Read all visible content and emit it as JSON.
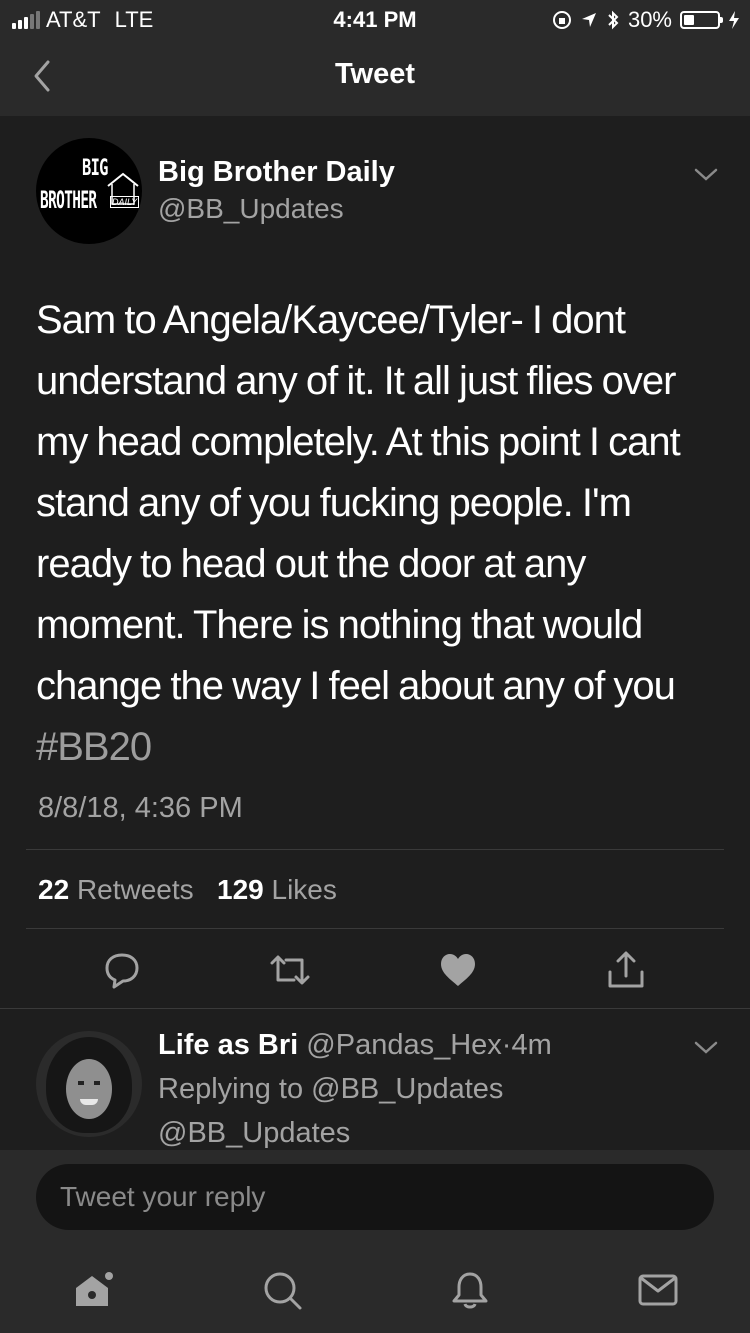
{
  "status_bar": {
    "carrier": "AT&T",
    "network": "LTE",
    "time": "4:41 PM",
    "battery": "30%",
    "icons": [
      "signal-icon",
      "orientation-lock-icon",
      "location-icon",
      "bluetooth-icon",
      "battery-icon",
      "charging-icon"
    ]
  },
  "nav": {
    "title": "Tweet",
    "back_icon": "chevron-left-icon"
  },
  "tweet": {
    "author_name": "Big Brother Daily",
    "author_handle": "@BB_Updates",
    "avatar_logo": {
      "line1": "BIG",
      "line2": "BROTHER",
      "tag": "DAILY"
    },
    "text": "Sam to Angela/Kaycee/Tyler- I dont understand any of it. It all just flies over my head completely. At this point I cant stand any of you fucking people. I'm ready to head out the door at any moment. There is nothing that would change the way I feel about any of you",
    "hashtag": "#BB20",
    "timestamp": "8/8/18, 4:36 PM",
    "retweets_count": "22",
    "retweets_label": "Retweets",
    "likes_count": "129",
    "likes_label": "Likes",
    "actions": [
      "reply-icon",
      "retweet-icon",
      "like-icon",
      "share-icon"
    ]
  },
  "reply": {
    "name": "Life as Bri",
    "handle": "@Pandas_Hex",
    "separator": "·",
    "age": "4m",
    "replying_to": "Replying to @BB_Updates",
    "text_preview": "@BB_Updates"
  },
  "composer": {
    "placeholder": "Tweet your reply"
  },
  "tab_bar": {
    "items": [
      "home-icon",
      "search-icon",
      "notifications-icon",
      "messages-icon"
    ]
  },
  "colors": {
    "background": "#1e1e1e",
    "bar": "#2a2a2a",
    "secondary_text": "#a3a3a3",
    "divider": "#3a3a3a"
  }
}
